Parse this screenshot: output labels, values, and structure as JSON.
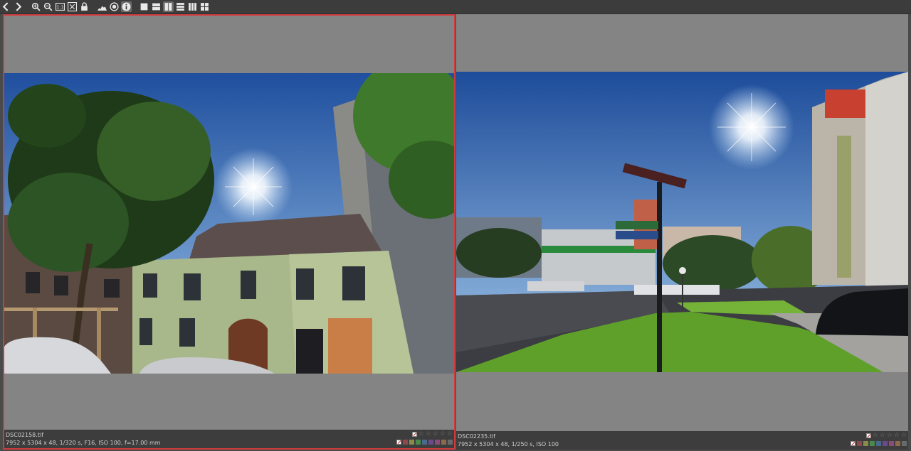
{
  "toolbar": {
    "buttons": [
      {
        "name": "prev-icon",
        "active": false
      },
      {
        "name": "next-icon",
        "active": false
      },
      {
        "name": "zoom-in-icon",
        "active": false
      },
      {
        "name": "zoom-out-icon",
        "active": false
      },
      {
        "name": "zoom-100-icon",
        "label": "1:1",
        "active": false
      },
      {
        "name": "zoom-fit-icon",
        "active": false
      },
      {
        "name": "lock-icon",
        "active": false
      },
      {
        "name": "histogram-icon",
        "active": false
      },
      {
        "name": "focus-icon",
        "active": false
      },
      {
        "name": "info-icon",
        "active": true
      },
      {
        "name": "layout-single-icon",
        "active": false
      },
      {
        "name": "layout-two-rows-icon",
        "active": false
      },
      {
        "name": "layout-two-columns-icon",
        "active": true
      },
      {
        "name": "layout-three-rows-icon",
        "active": false
      },
      {
        "name": "layout-three-columns-icon",
        "active": false
      },
      {
        "name": "layout-grid-icon",
        "active": false
      }
    ]
  },
  "panes": [
    {
      "filename": "DSC02158.tif",
      "meta": "7952 x 5304 x 48, 1/320 s, F16, ISO 100, f=17.00 mm",
      "selected": true
    },
    {
      "filename": "DSC02235.tif",
      "meta": "7952 x 5304 x 48, 1/250 s, ISO 100",
      "selected": false
    }
  ],
  "color_labels": [
    "#8a4a4a",
    "#8a8a4a",
    "#4a8a4a",
    "#4a6a8a",
    "#6a4a8a",
    "#8a4a7a",
    "#8a6a4a",
    "#6a6a6a"
  ],
  "accent": "#d03c3c"
}
